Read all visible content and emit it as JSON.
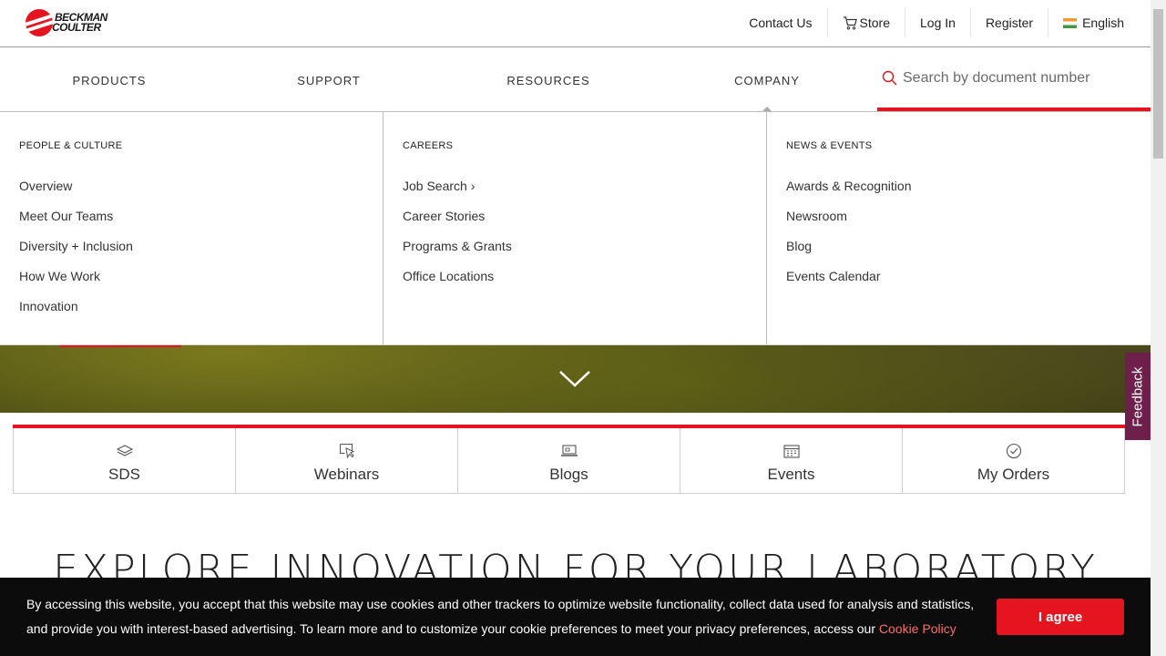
{
  "brand": {
    "logo_line1": "BECKMAN",
    "logo_line2": "COULTER",
    "accent_color": "#e4151f"
  },
  "utility_nav": {
    "contact": "Contact Us",
    "store": "Store",
    "login": "Log In",
    "register": "Register",
    "language": "English"
  },
  "main_nav": {
    "items": [
      "PRODUCTS",
      "SUPPORT",
      "RESOURCES",
      "COMPANY"
    ],
    "active": "COMPANY",
    "search_placeholder": "Search by document number"
  },
  "mega_menu": {
    "columns": [
      {
        "heading": "PEOPLE & CULTURE",
        "links": [
          "Overview",
          "Meet Our Teams",
          "Diversity + Inclusion",
          "How We Work",
          "Innovation"
        ]
      },
      {
        "heading": "CAREERS",
        "links": [
          "Job Search ›",
          "Career Stories",
          "Programs & Grants",
          "Office Locations"
        ]
      },
      {
        "heading": "NEWS & EVENTS",
        "links": [
          "Awards & Recognition",
          "Newsroom",
          "Blog",
          "Events Calendar"
        ]
      }
    ]
  },
  "quick_links": [
    {
      "label": "SDS",
      "icon": "layers-icon"
    },
    {
      "label": "Webinars",
      "icon": "webinar-cursor-icon"
    },
    {
      "label": "Blogs",
      "icon": "laptop-icon"
    },
    {
      "label": "Events",
      "icon": "calendar-icon"
    },
    {
      "label": "My Orders",
      "icon": "check-circle-icon"
    }
  ],
  "section_heading": "EXPLORE INNOVATION FOR YOUR LABORATORY",
  "feedback_label": "Feedback",
  "cookie_banner": {
    "text": "By accessing this website, you accept that this website may use cookies and other trackers to optimize website functionality, collect data used for analysis and statistics, and provide you with interest-based advertising. To learn more and to customize your cookie preferences to meet your privacy preferences, access our ",
    "policy_link": "Cookie Policy",
    "agree_button": "I agree"
  }
}
